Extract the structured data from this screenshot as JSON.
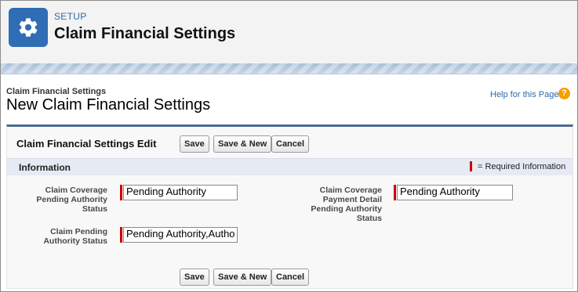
{
  "header": {
    "icon": "gear-icon",
    "eyebrow": "SETUP",
    "title": "Claim Financial Settings"
  },
  "page": {
    "breadcrumb": "Claim Financial Settings",
    "title": "New Claim Financial Settings",
    "help_link": "Help for this Page",
    "help_icon_glyph": "?"
  },
  "edit_block": {
    "title": "Claim Financial Settings Edit",
    "buttons": {
      "save": "Save",
      "save_new": "Save & New",
      "cancel": "Cancel"
    }
  },
  "section": {
    "title": "Information",
    "required_note": "= Required Information"
  },
  "fields": {
    "coverage_pending": {
      "label_lines": [
        "Claim Coverage",
        "Pending Authority",
        "Status"
      ],
      "value": "Pending Authority"
    },
    "payment_detail_pending": {
      "label_lines": [
        "Claim Coverage",
        "Payment Detail",
        "Pending Authority",
        "Status"
      ],
      "value": "Pending Authority"
    },
    "claim_pending": {
      "label_lines": [
        "Claim Pending",
        "Authority Status"
      ],
      "value": "Pending Authority,Autho"
    }
  },
  "colors": {
    "accent_blue": "#2f6db4",
    "required_red": "#cc0000",
    "block_border": "#4a6a8f"
  }
}
